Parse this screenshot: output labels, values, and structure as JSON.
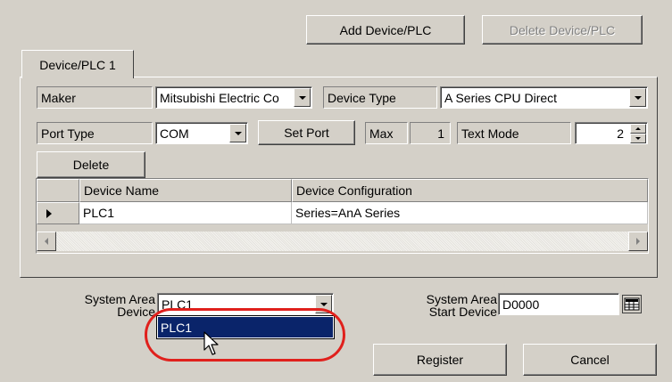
{
  "toolbar": {
    "add_label": "Add Device/PLC",
    "delete_label": "Delete Device/PLC"
  },
  "tab": {
    "label": "Device/PLC 1"
  },
  "fields": {
    "maker_label": "Maker",
    "maker_value": "Mitsubishi Electric Co",
    "device_type_label": "Device Type",
    "device_type_value": "A Series CPU Direct",
    "port_type_label": "Port Type",
    "port_type_value": "COM",
    "set_port_label": "Set Port",
    "max_label": "Max",
    "max_value": "1",
    "text_mode_label": "Text Mode",
    "text_mode_value": "2"
  },
  "grid": {
    "delete_label": "Delete",
    "columns": [
      "Device Name",
      "Device Configuration"
    ],
    "rows": [
      {
        "name": "PLC1",
        "config": "Series=AnA Series"
      }
    ]
  },
  "system_area": {
    "device_label_1": "System Area",
    "device_label_2": "Device",
    "device_value": "PLC1",
    "dropdown_option": "PLC1",
    "start_label_1": "System Area",
    "start_label_2": "Start Device",
    "start_value": "D0000"
  },
  "footer": {
    "register_label": "Register",
    "cancel_label": "Cancel"
  },
  "colors": {
    "dialog_bg": "#d4d0c8",
    "selection": "#0a246a",
    "highlight_circle": "#e0201c"
  }
}
